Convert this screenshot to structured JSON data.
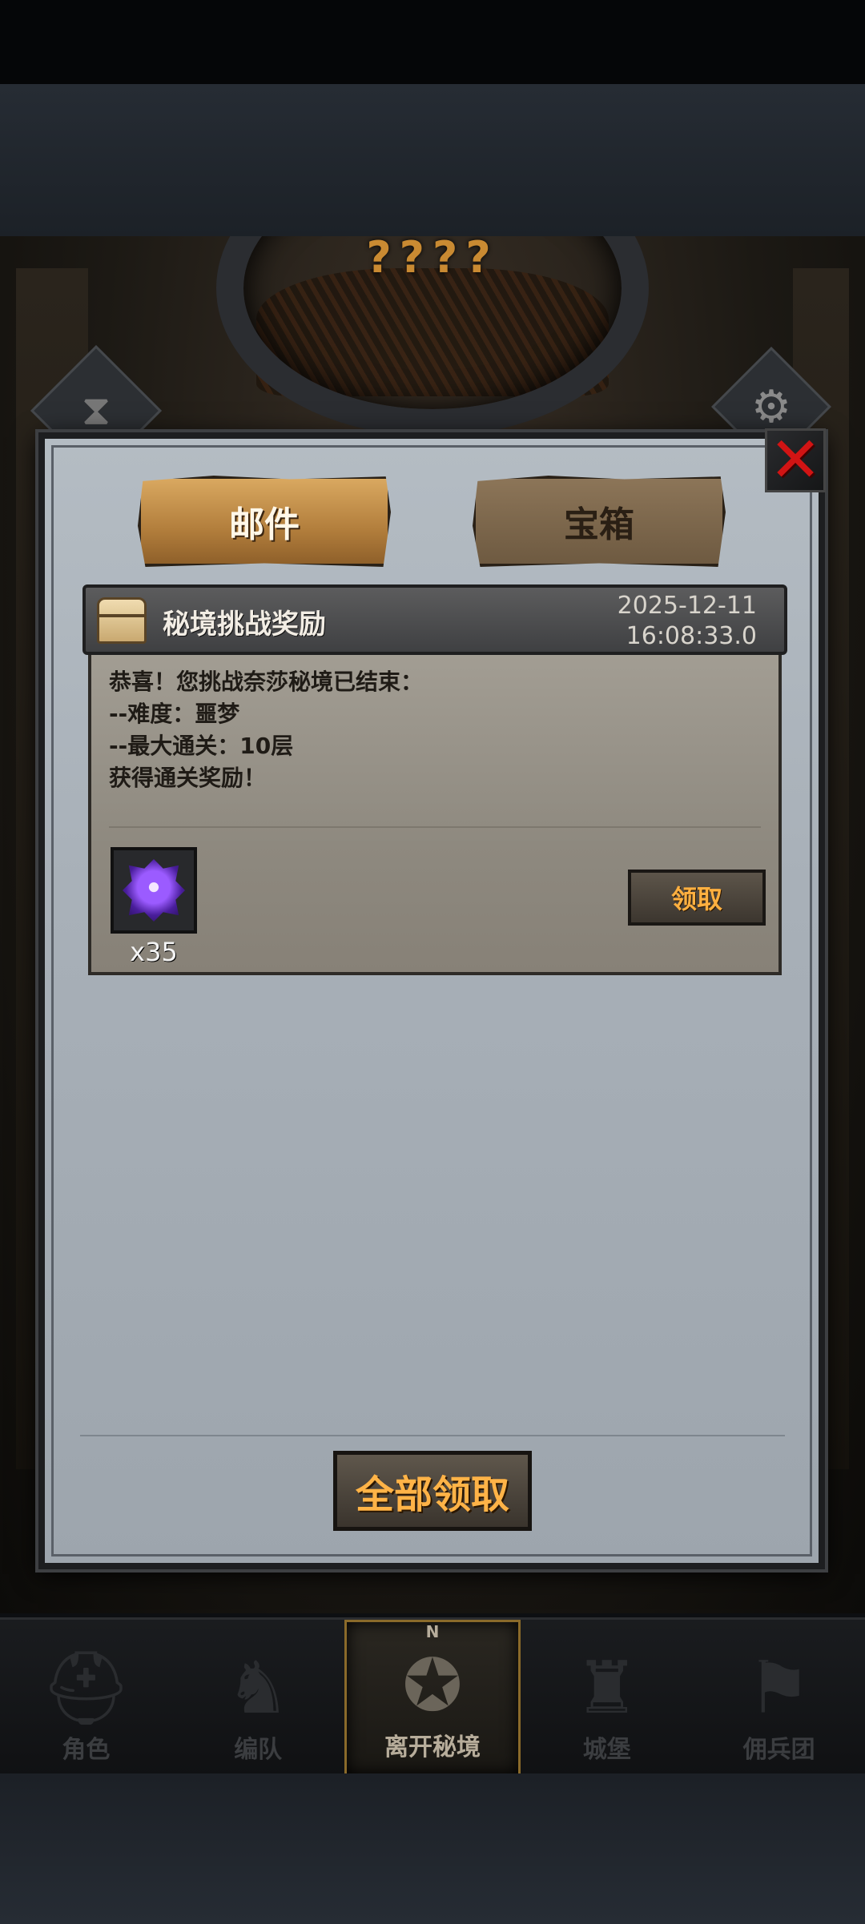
{
  "scene": {
    "secret_title": "????"
  },
  "tabs": [
    {
      "label": "邮件",
      "active": true
    },
    {
      "label": "宝箱",
      "active": false
    }
  ],
  "mail": {
    "title": "秘境挑战奖励",
    "date": "2025-12-11",
    "time": "16:08:33.0",
    "body_lines": [
      "恭喜！您挑战奈莎秘境已结束：",
      "--难度：噩梦",
      "--最大通关：10层",
      "获得通关奖励！"
    ],
    "reward": {
      "icon": "purple-gem-icon",
      "count": "x35"
    },
    "claim_label": "领取"
  },
  "claim_all_label": "全部领取",
  "nav": [
    {
      "label": "角色",
      "icon": "helmet-icon"
    },
    {
      "label": "编队",
      "icon": "knight-icon"
    },
    {
      "label": "离开秘境",
      "icon": "compass-icon",
      "active": true
    },
    {
      "label": "城堡",
      "icon": "castle-icon"
    },
    {
      "label": "佣兵团",
      "icon": "banner-icon"
    }
  ],
  "colors": {
    "accent_orange": "#ffb040",
    "close_red": "#d11414",
    "panel_bg": "#a8b0b8",
    "nav_active_border": "#8a6a2a"
  }
}
